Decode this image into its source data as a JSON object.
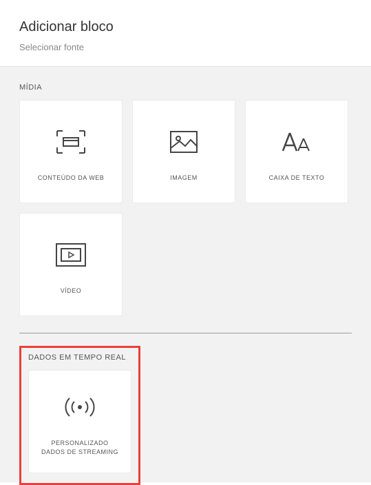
{
  "header": {
    "title": "Adicionar bloco",
    "subtitle": "Selecionar fonte"
  },
  "sections": {
    "media": {
      "label": "MÍDIA",
      "tiles": {
        "web_content": "CONTEÚDO DA WEB",
        "image": "IMAGEM",
        "text_box": "CAIXA DE TEXTO",
        "video": "VÍDEO"
      }
    },
    "realtime": {
      "label": "DADOS EM TEMPO REAL",
      "tiles": {
        "streaming_line1": "PERSONALIZADO",
        "streaming_line2": "DADOS DE STREAMING"
      }
    }
  }
}
